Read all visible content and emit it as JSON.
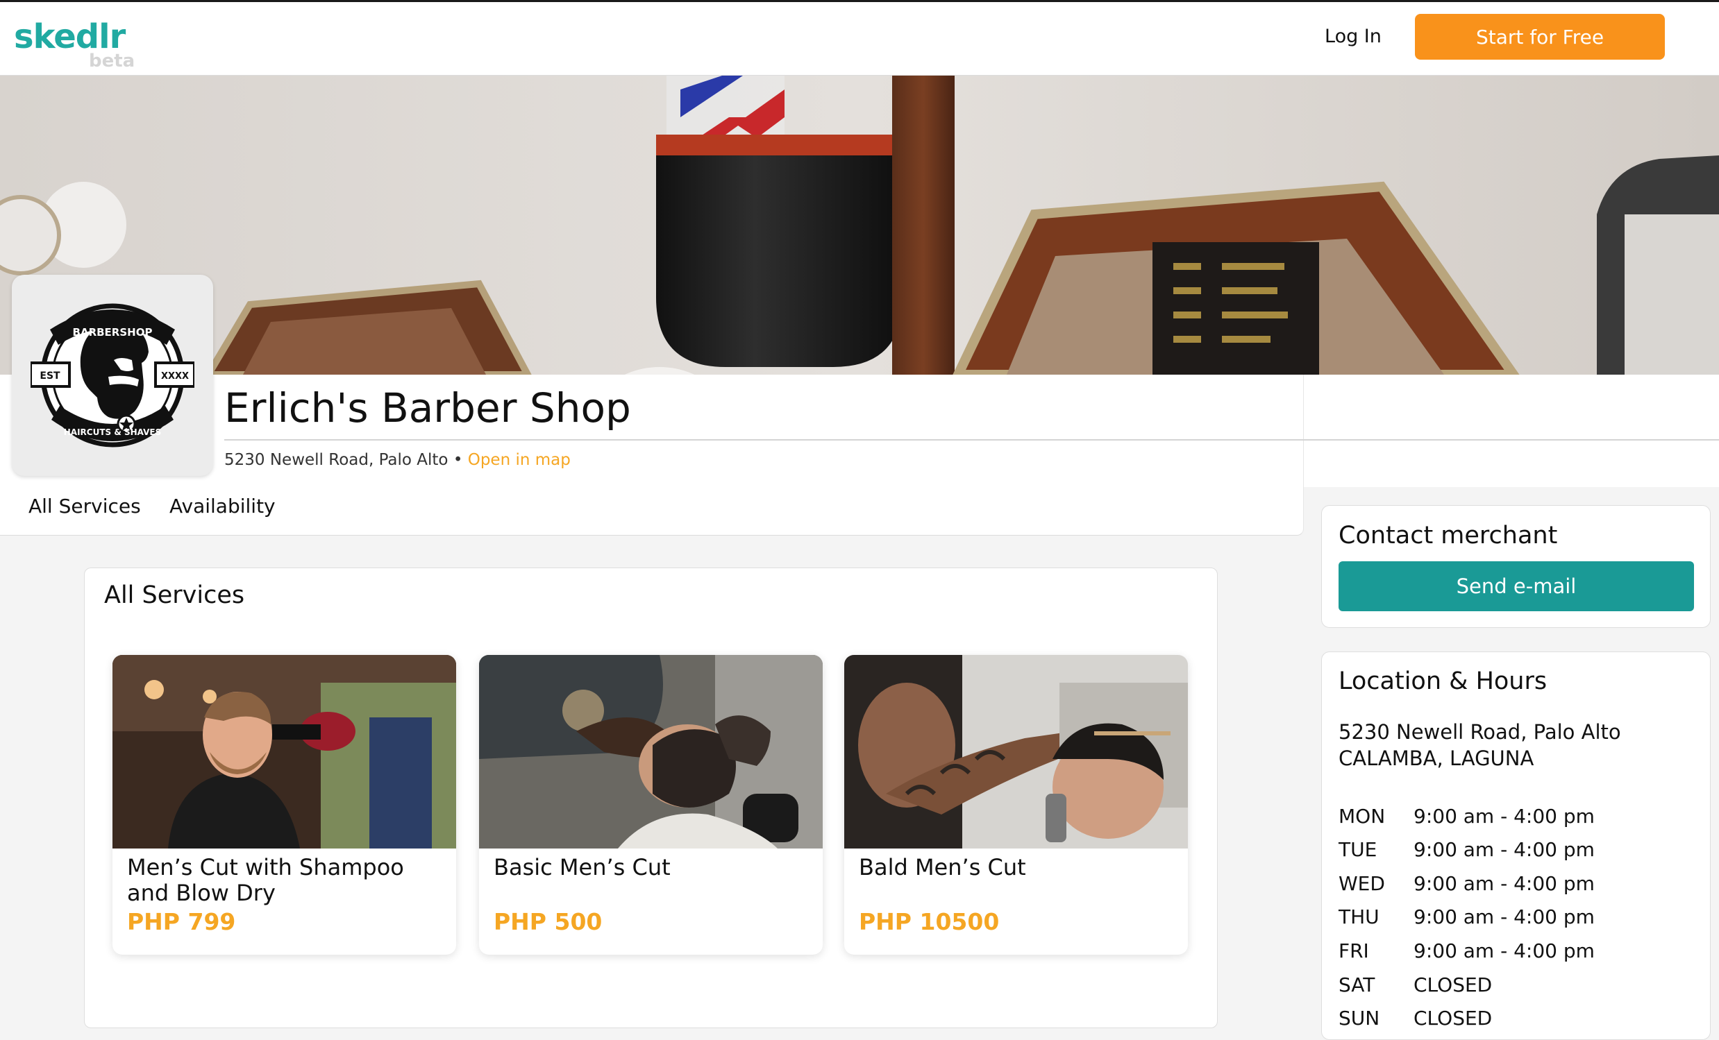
{
  "nav": {
    "logo_text": "skedlr",
    "logo_badge": "beta",
    "login_label": "Log In",
    "start_label": "Start for Free"
  },
  "colors": {
    "brand_teal": "#21aaa2",
    "cta_orange": "#f9921b",
    "price_orange": "#f5a623",
    "email_button": "#1a9a96"
  },
  "shop": {
    "name": "Erlich's Barber Shop",
    "address": "5230 Newell Road, Palo Alto",
    "separator": "•",
    "map_link": "Open in map",
    "logo": {
      "top_text": "BARBERSHOP",
      "left_text": "EST",
      "right_text": "XXXX",
      "bottom_text": "HAIRCUTS & SHAVES"
    }
  },
  "tabs": [
    {
      "label": "All Services"
    },
    {
      "label": "Availability"
    }
  ],
  "services": {
    "title": "All Services",
    "items": [
      {
        "name": "Men’s Cut with Shampoo and Blow Dry",
        "price": "PHP 799",
        "photo": "barber-blowdry-photo"
      },
      {
        "name": "Basic Men’s Cut",
        "price": "PHP 500",
        "photo": "beard-trim-photo"
      },
      {
        "name": "Bald Men’s Cut",
        "price": "PHP 10500",
        "photo": "clipper-cut-photo"
      }
    ]
  },
  "contact": {
    "title": "Contact merchant",
    "button_label": "Send e-mail"
  },
  "location": {
    "title": "Location & Hours",
    "address_line1": "5230 Newell Road, Palo Alto",
    "address_line2": "CALAMBA, LAGUNA",
    "hours": [
      {
        "day": "MON",
        "time": "9:00 am - 4:00 pm"
      },
      {
        "day": "TUE",
        "time": "9:00 am - 4:00 pm"
      },
      {
        "day": "WED",
        "time": "9:00 am - 4:00 pm"
      },
      {
        "day": "THU",
        "time": "9:00 am - 4:00 pm"
      },
      {
        "day": "FRI",
        "time": "9:00 am - 4:00 pm"
      },
      {
        "day": "SAT",
        "time": "CLOSED"
      },
      {
        "day": "SUN",
        "time": "CLOSED"
      }
    ]
  }
}
